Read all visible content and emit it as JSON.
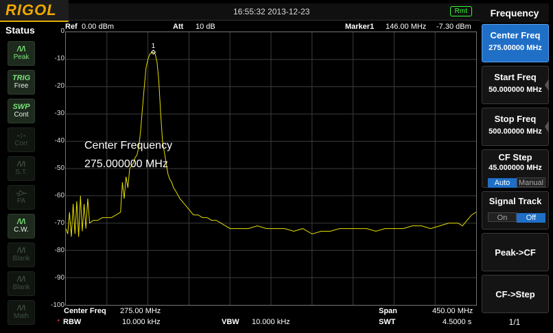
{
  "app": {
    "logo": "RIGOL",
    "datetime": "16:55:32 2013-12-23",
    "remote_badge": "Rmt"
  },
  "status_panel": {
    "title": "Status",
    "items": [
      {
        "icon": "peak-icon",
        "icon_glyph": "/\\/\\",
        "label": "Peak",
        "active": true
      },
      {
        "icon": "trig-icon",
        "icon_glyph": "TRIG",
        "label": "Free",
        "active": true
      },
      {
        "icon": "sweep-icon",
        "icon_glyph": "SWP",
        "label": "Cont",
        "active": true
      },
      {
        "icon": "corr-icon",
        "icon_glyph": "-↕-",
        "label": "Corr",
        "active": false
      },
      {
        "icon": "st-icon",
        "icon_glyph": "/\\/\\",
        "label": "S.T.",
        "active": false
      },
      {
        "icon": "pa-icon",
        "icon_glyph": "-▷-",
        "label": "PA",
        "active": false
      },
      {
        "icon": "cw-icon",
        "icon_glyph": "/\\/\\",
        "label": "C.W.",
        "active": true
      },
      {
        "icon": "blank-icon",
        "icon_glyph": "/\\/\\",
        "label": "Blank",
        "active": false
      },
      {
        "icon": "blank-icon",
        "icon_glyph": "/\\/\\",
        "label": "Blank",
        "active": false
      },
      {
        "icon": "math-icon",
        "icon_glyph": "/\\/\\",
        "label": "Math",
        "active": false
      }
    ]
  },
  "header": {
    "ref_label": "Ref",
    "ref_value": "0.00 dBm",
    "att_label": "Att",
    "att_value": "10 dB",
    "marker_label": "Marker1",
    "marker_freq": "146.00 MHz",
    "marker_level": "-7.30 dBm"
  },
  "overlay": {
    "line1": "Center Frequency",
    "line2": "275.000000 MHz"
  },
  "marker_tag": "1",
  "footer": {
    "center_label": "Center Freq",
    "center_value": "275.00 MHz",
    "span_label": "Span",
    "span_value": "450.00 MHz",
    "rbw_star": "*",
    "rbw_label": "RBW",
    "rbw_value": "10.000 kHz",
    "vbw_label": "VBW",
    "vbw_value": "10.000 kHz",
    "swt_label": "SWT",
    "swt_value": "4.5000 s"
  },
  "menu": {
    "title": "Frequency",
    "center_freq": {
      "label": "Center Freq",
      "value": "275.00000 MHz"
    },
    "start_freq": {
      "label": "Start Freq",
      "value": "50.000000 MHz"
    },
    "stop_freq": {
      "label": "Stop Freq",
      "value": "500.00000 MHz"
    },
    "cf_step": {
      "label": "CF Step",
      "value": "45.000000 MHz",
      "opt_auto": "Auto",
      "opt_manual": "Manual"
    },
    "signal_track": {
      "label": "Signal Track",
      "opt_on": "On",
      "opt_off": "Off"
    },
    "peak_to_cf": "Peak->CF",
    "cf_to_step": "CF->Step",
    "page": "1/1"
  },
  "chart_data": {
    "type": "line",
    "ylabel_ticks": [
      "0",
      "-10",
      "-20",
      "-30",
      "-40",
      "-50",
      "-60",
      "-70",
      "-80",
      "-90",
      "-100"
    ],
    "ylim": [
      -100,
      0
    ],
    "xlim_mhz": [
      50,
      500
    ],
    "grid": true,
    "trace_color": "#e8e000",
    "series": [
      {
        "x": [
          50,
          52,
          54,
          56,
          58,
          60,
          62,
          64,
          66,
          68,
          70,
          72,
          74,
          76,
          80,
          85,
          90,
          95,
          100,
          105,
          110,
          112,
          114,
          116,
          118,
          120,
          122,
          124,
          126,
          128,
          130,
          132,
          134,
          136,
          138,
          140,
          142,
          144,
          146,
          148,
          150,
          152,
          154,
          156,
          158,
          160,
          162,
          164,
          166,
          168,
          170,
          175,
          180,
          185,
          190,
          195,
          200,
          205,
          210,
          215,
          220,
          225,
          230,
          240,
          250,
          260,
          270,
          280,
          290,
          300,
          310,
          320,
          330,
          340,
          350,
          360,
          370,
          380,
          390,
          400,
          410,
          420,
          430,
          440,
          450,
          460,
          470,
          475,
          480,
          485,
          490,
          495,
          500
        ],
        "y": [
          -72,
          -74,
          -66,
          -75,
          -63,
          -74,
          -62,
          -75,
          -60,
          -73,
          -63,
          -72,
          -61,
          -70,
          -69,
          -69,
          -68,
          -68,
          -68,
          -67,
          -66,
          -55,
          -61,
          -53,
          -57,
          -50,
          -49,
          -48,
          -46,
          -45,
          -42,
          -36,
          -28,
          -20,
          -13,
          -10,
          -8,
          -7.5,
          -7.3,
          -8,
          -11,
          -18,
          -30,
          -40,
          -44,
          -48,
          -52,
          -54,
          -55,
          -57,
          -58,
          -61,
          -63,
          -65,
          -67,
          -67,
          -68,
          -68,
          -69,
          -69,
          -70,
          -71,
          -72,
          -72,
          -72,
          -71,
          -72,
          -72,
          -72,
          -73,
          -72,
          -74,
          -73,
          -73,
          -72,
          -72,
          -72,
          -72,
          -73,
          -72,
          -72,
          -72,
          -71,
          -71,
          -72,
          -71,
          -70,
          -70,
          -70,
          -71,
          -69,
          -67,
          -66
        ]
      }
    ],
    "markers": [
      {
        "name": "1",
        "x": 146.0,
        "y": -7.3
      }
    ]
  }
}
